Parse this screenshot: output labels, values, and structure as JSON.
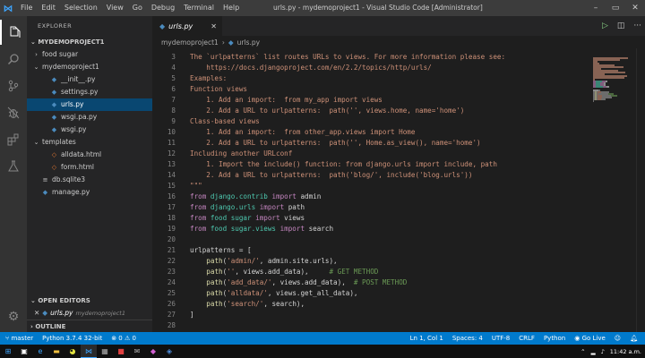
{
  "titlebar": {
    "menu": [
      "File",
      "Edit",
      "Selection",
      "View",
      "Go",
      "Debug",
      "Terminal",
      "Help"
    ],
    "title": "urls.py - mydemoproject1 - Visual Studio Code [Administrator]"
  },
  "sidebar": {
    "header": "EXPLORER",
    "project": "MYDEMOPROJECT1",
    "tree": [
      {
        "label": "food sugar",
        "type": "folder",
        "level": 1,
        "expanded": false
      },
      {
        "label": "mydemoproject1",
        "type": "folder",
        "level": 1,
        "expanded": true
      },
      {
        "label": "__init__.py",
        "type": "py",
        "level": 2
      },
      {
        "label": "settings.py",
        "type": "py",
        "level": 2
      },
      {
        "label": "urls.py",
        "type": "py",
        "level": 2,
        "selected": true
      },
      {
        "label": "wsgi.pa.py",
        "type": "py",
        "level": 2
      },
      {
        "label": "wsgi.py",
        "type": "py",
        "level": 2
      },
      {
        "label": "templates",
        "type": "folder",
        "level": 1,
        "expanded": true
      },
      {
        "label": "alldata.html",
        "type": "html",
        "level": 2
      },
      {
        "label": "form.html",
        "type": "html",
        "level": 2
      },
      {
        "label": "db.sqlite3",
        "type": "db",
        "level": 1
      },
      {
        "label": "manage.py",
        "type": "py",
        "level": 1
      }
    ],
    "open_editors_label": "OPEN EDITORS",
    "open_editor": {
      "name": "urls.py",
      "folder": "mydemoproject1"
    },
    "outline_label": "OUTLINE"
  },
  "tab": {
    "label": "urls.py"
  },
  "breadcrumb": {
    "folder": "mydemoproject1",
    "file": "urls.py"
  },
  "editor": {
    "lines": [
      {
        "n": "3",
        "tokens": [
          [
            "str",
            "The `urlpatterns` list routes URLs to views. For more information please see:"
          ]
        ]
      },
      {
        "n": "4",
        "tokens": [
          [
            "str",
            "    https://docs.djangoproject.com/en/2.2/topics/http/urls/"
          ]
        ]
      },
      {
        "n": "5",
        "tokens": [
          [
            "str",
            "Examples:"
          ]
        ]
      },
      {
        "n": "6",
        "tokens": [
          [
            "str",
            "Function views"
          ]
        ]
      },
      {
        "n": "7",
        "tokens": [
          [
            "str",
            "    1. Add an import:  from my_app import views"
          ]
        ]
      },
      {
        "n": "8",
        "tokens": [
          [
            "str",
            "    2. Add a URL to urlpatterns:  path('', views.home, name='home')"
          ]
        ]
      },
      {
        "n": "9",
        "tokens": [
          [
            "str",
            "Class-based views"
          ]
        ]
      },
      {
        "n": "10",
        "tokens": [
          [
            "str",
            "    1. Add an import:  from other_app.views import Home"
          ]
        ]
      },
      {
        "n": "11",
        "tokens": [
          [
            "str",
            "    2. Add a URL to urlpatterns:  path('', Home.as_view(), name='home')"
          ]
        ]
      },
      {
        "n": "12",
        "tokens": [
          [
            "str",
            "Including another URLconf"
          ]
        ]
      },
      {
        "n": "13",
        "tokens": [
          [
            "str",
            "    1. Import the include() function: from django.urls import include, path"
          ]
        ]
      },
      {
        "n": "14",
        "tokens": [
          [
            "str",
            "    2. Add a URL to urlpatterns:  path('blog/', include('blog.urls'))"
          ]
        ]
      },
      {
        "n": "15",
        "tokens": [
          [
            "str",
            "\"\"\""
          ]
        ]
      },
      {
        "n": "16",
        "tokens": [
          [
            "kw",
            "from "
          ],
          [
            "mod",
            "django.contrib"
          ],
          [
            "kw",
            " import "
          ],
          [
            "id",
            "admin"
          ]
        ]
      },
      {
        "n": "17",
        "tokens": [
          [
            "kw",
            "from "
          ],
          [
            "mod",
            "django.urls"
          ],
          [
            "kw",
            " import "
          ],
          [
            "id",
            "path"
          ]
        ]
      },
      {
        "n": "18",
        "tokens": [
          [
            "kw",
            "from "
          ],
          [
            "mod",
            "food sugar"
          ],
          [
            "kw",
            " import "
          ],
          [
            "id",
            "views"
          ]
        ]
      },
      {
        "n": "19",
        "tokens": [
          [
            "kw",
            "from "
          ],
          [
            "mod",
            "food sugar.views"
          ],
          [
            "kw",
            " import "
          ],
          [
            "id",
            "search"
          ]
        ]
      },
      {
        "n": "20",
        "tokens": []
      },
      {
        "n": "21",
        "tokens": [
          [
            "id",
            "urlpatterns"
          ],
          [
            "pl",
            " = ["
          ]
        ]
      },
      {
        "n": "22",
        "tokens": [
          [
            "pl",
            "    "
          ],
          [
            "fn",
            "path"
          ],
          [
            "pl",
            "("
          ],
          [
            "str",
            "'admin/'"
          ],
          [
            "pl",
            ", admin.site.urls),"
          ]
        ]
      },
      {
        "n": "23",
        "tokens": [
          [
            "pl",
            "    "
          ],
          [
            "fn",
            "path"
          ],
          [
            "pl",
            "("
          ],
          [
            "str",
            "''"
          ],
          [
            "pl",
            ", views.add_data),     "
          ],
          [
            "cm",
            "# GET METHOD"
          ]
        ]
      },
      {
        "n": "24",
        "tokens": [
          [
            "pl",
            "    "
          ],
          [
            "fn",
            "path"
          ],
          [
            "pl",
            "("
          ],
          [
            "str",
            "'add_data/'"
          ],
          [
            "pl",
            ", views.add_data),  "
          ],
          [
            "cm",
            "# POST METHOD"
          ]
        ]
      },
      {
        "n": "25",
        "tokens": [
          [
            "pl",
            "    "
          ],
          [
            "fn",
            "path"
          ],
          [
            "pl",
            "("
          ],
          [
            "str",
            "'alldata/'"
          ],
          [
            "pl",
            ", views.get_all_data),"
          ]
        ]
      },
      {
        "n": "26",
        "tokens": [
          [
            "pl",
            "    "
          ],
          [
            "fn",
            "path"
          ],
          [
            "pl",
            "("
          ],
          [
            "str",
            "'search/'"
          ],
          [
            "pl",
            ", search),"
          ]
        ]
      },
      {
        "n": "27",
        "tokens": [
          [
            "pl",
            "]"
          ]
        ]
      },
      {
        "n": "28",
        "tokens": []
      }
    ]
  },
  "statusbar": {
    "branch": "master",
    "python": "Python 3.7.4 32-bit",
    "problems": "⊗ 0 ⚠ 0",
    "position": "Ln 1, Col 1",
    "spaces": "Spaces: 4",
    "encoding": "UTF-8",
    "eol": "CRLF",
    "language": "Python",
    "golive": "Go Live"
  },
  "taskbar": {
    "time": "11:42 a.m."
  },
  "colors": {
    "accent": "#007acc",
    "selection": "#094771",
    "string": "#ce9178",
    "keyword": "#c586c0",
    "module": "#4ec9b0",
    "function": "#dcdcaa",
    "comment": "#6a9955"
  }
}
